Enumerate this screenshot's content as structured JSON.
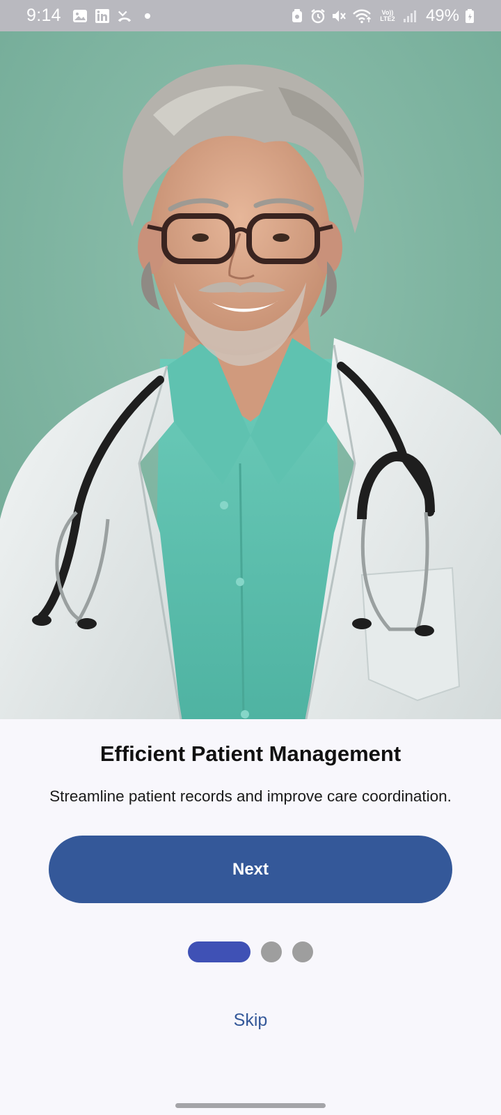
{
  "status_bar": {
    "time": "9:14",
    "battery": "49%",
    "network_label": "Vo)) LTE2",
    "icons_left": [
      "gallery-icon",
      "linkedin-icon",
      "missed-call-icon",
      "notification-dot"
    ],
    "icons_right": [
      "vpn-icon",
      "alarm-icon",
      "mute-icon",
      "wifi-icon",
      "signal-icon",
      "battery-icon"
    ]
  },
  "hero": {
    "image": "doctor-portrait",
    "colors": {
      "background": "#7fb3a1",
      "coat": "#e8ecec",
      "shirt": "#5cbfae",
      "hair": "#b8b4ae",
      "skin": "#d9a88c"
    }
  },
  "onboarding": {
    "title": "Efficient Patient Management",
    "subtitle": "Streamline patient records and improve care coordination.",
    "next_label": "Next",
    "skip_label": "Skip",
    "page_count": 3,
    "active_page": 1
  },
  "colors": {
    "primary": "#345899",
    "indicator_active": "#3f51b5",
    "indicator_inactive": "#9e9e9e",
    "background": "#f8f7fc"
  }
}
